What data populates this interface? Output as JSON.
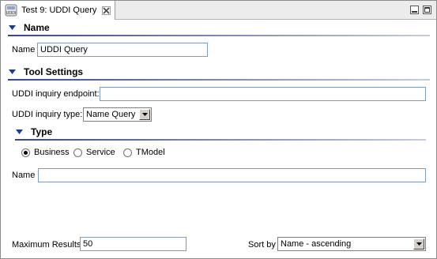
{
  "tab": {
    "title": "Test 9: UDDI Query",
    "icon": "uddi-icon"
  },
  "window_controls": {
    "minimize_icon": "minimize-icon",
    "maximize_icon": "maximize-icon"
  },
  "colors": {
    "section_blue": "#1c3d8c",
    "rule_blue": "#7a8fc6"
  },
  "name_section": {
    "header": "Name",
    "name_label": "Name",
    "name_value": "UDDI Query"
  },
  "tool_settings": {
    "header": "Tool Settings",
    "endpoint_label": "UDDI inquiry endpoint:",
    "endpoint_value": "",
    "type_label": "UDDI inquiry type:",
    "type_value": "Name Query"
  },
  "type_section": {
    "header": "Type",
    "options": [
      {
        "label": "Business",
        "checked": true
      },
      {
        "label": "Service",
        "checked": false
      },
      {
        "label": "TModel",
        "checked": false
      }
    ],
    "name_label": "Name",
    "name_value": ""
  },
  "footer": {
    "max_results_label": "Maximum Results",
    "max_results_value": "50",
    "sort_label": "Sort by",
    "sort_value": "Name - ascending"
  }
}
